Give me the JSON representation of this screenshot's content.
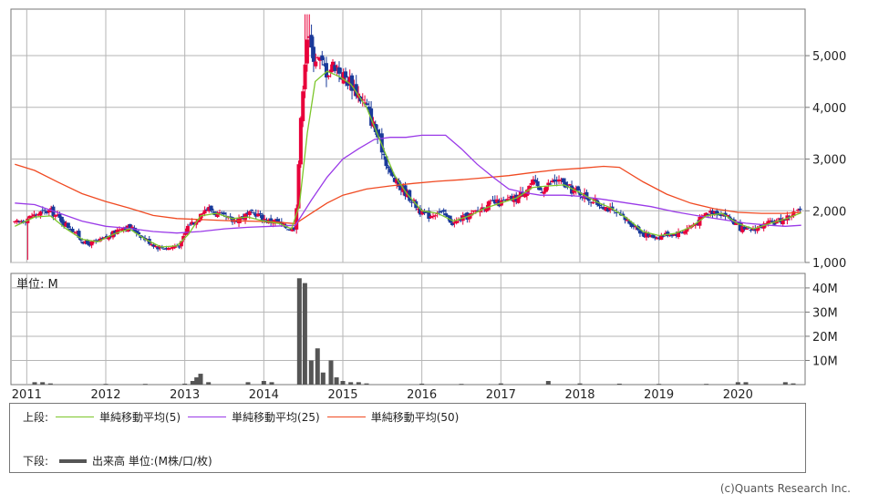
{
  "colors": {
    "up": "#e8003a",
    "down": "#1a3a9a",
    "sma5": "#7cc62a",
    "sma25": "#9a3ae8",
    "sma50": "#f04a22",
    "volume": "#555555",
    "grid": "#b5b5b5"
  },
  "price_axis": {
    "ticks": [
      1000,
      2000,
      3000,
      4000,
      5000
    ],
    "labels": [
      "1,000",
      "2,000",
      "3,000",
      "4,000",
      "5,000"
    ]
  },
  "volume_axis": {
    "unit_label": "単位: M",
    "ticks": [
      10,
      20,
      30,
      40
    ],
    "labels": [
      "10M",
      "20M",
      "30M",
      "40M"
    ]
  },
  "x_labels": [
    "2011",
    "2012",
    "2013",
    "2014",
    "2015",
    "2016",
    "2017",
    "2018",
    "2019",
    "2020"
  ],
  "legend": {
    "upper_label": "上段:",
    "sma5_label": "単純移動平均(5)",
    "sma25_label": "単純移動平均(25)",
    "sma50_label": "単純移動平均(50)",
    "lower_label": "下段:",
    "volume_label": "出来高 単位:(M株/口/枚)"
  },
  "copyright": "(c)Quants Research Inc.",
  "chart_data": {
    "type": "candlestick",
    "price_ylim": [
      1000,
      5900
    ],
    "volume_ylim": [
      0,
      46
    ],
    "x_range": [
      2010.8,
      2020.85
    ],
    "close_path": [
      [
        2010.85,
        1750
      ],
      [
        2011.0,
        1850
      ],
      [
        2011.15,
        1950
      ],
      [
        2011.3,
        2000
      ],
      [
        2011.45,
        1800
      ],
      [
        2011.6,
        1600
      ],
      [
        2011.75,
        1350
      ],
      [
        2011.9,
        1400
      ],
      [
        2012.05,
        1500
      ],
      [
        2012.2,
        1700
      ],
      [
        2012.35,
        1650
      ],
      [
        2012.5,
        1450
      ],
      [
        2012.65,
        1300
      ],
      [
        2012.8,
        1280
      ],
      [
        2012.95,
        1350
      ],
      [
        2013.05,
        1750
      ],
      [
        2013.15,
        1800
      ],
      [
        2013.2,
        2000
      ],
      [
        2013.3,
        2050
      ],
      [
        2013.45,
        1900
      ],
      [
        2013.6,
        1800
      ],
      [
        2013.75,
        1900
      ],
      [
        2013.9,
        1950
      ],
      [
        2014.05,
        1800
      ],
      [
        2014.15,
        1800
      ],
      [
        2014.25,
        1700
      ],
      [
        2014.35,
        1650
      ],
      [
        2014.4,
        1700
      ],
      [
        2014.45,
        3200
      ],
      [
        2014.5,
        4600
      ],
      [
        2014.55,
        5400
      ],
      [
        2014.6,
        5100
      ],
      [
        2014.7,
        4900
      ],
      [
        2014.8,
        4700
      ],
      [
        2014.9,
        4850
      ],
      [
        2015.0,
        4600
      ],
      [
        2015.1,
        4500
      ],
      [
        2015.2,
        4250
      ],
      [
        2015.3,
        4000
      ],
      [
        2015.4,
        3600
      ],
      [
        2015.5,
        3200
      ],
      [
        2015.6,
        2700
      ],
      [
        2015.7,
        2500
      ],
      [
        2015.8,
        2350
      ],
      [
        2015.9,
        2150
      ],
      [
        2016.0,
        1950
      ],
      [
        2016.1,
        1900
      ],
      [
        2016.2,
        2000
      ],
      [
        2016.3,
        1900
      ],
      [
        2016.4,
        1750
      ],
      [
        2016.5,
        1850
      ],
      [
        2016.6,
        1900
      ],
      [
        2016.7,
        2000
      ],
      [
        2016.8,
        2100
      ],
      [
        2016.9,
        2150
      ],
      [
        2017.0,
        2150
      ],
      [
        2017.1,
        2200
      ],
      [
        2017.2,
        2250
      ],
      [
        2017.3,
        2400
      ],
      [
        2017.4,
        2550
      ],
      [
        2017.5,
        2400
      ],
      [
        2017.6,
        2500
      ],
      [
        2017.7,
        2600
      ],
      [
        2017.8,
        2500
      ],
      [
        2017.9,
        2400
      ],
      [
        2018.0,
        2350
      ],
      [
        2018.1,
        2250
      ],
      [
        2018.2,
        2150
      ],
      [
        2018.3,
        2100
      ],
      [
        2018.4,
        2000
      ],
      [
        2018.5,
        1900
      ],
      [
        2018.6,
        1800
      ],
      [
        2018.7,
        1700
      ],
      [
        2018.8,
        1550
      ],
      [
        2018.9,
        1500
      ],
      [
        2019.0,
        1500
      ],
      [
        2019.1,
        1550
      ],
      [
        2019.2,
        1550
      ],
      [
        2019.3,
        1600
      ],
      [
        2019.4,
        1700
      ],
      [
        2019.5,
        1800
      ],
      [
        2019.6,
        1950
      ],
      [
        2019.7,
        2000
      ],
      [
        2019.8,
        1950
      ],
      [
        2019.9,
        1850
      ],
      [
        2020.0,
        1700
      ],
      [
        2020.1,
        1600
      ],
      [
        2020.2,
        1650
      ],
      [
        2020.3,
        1700
      ],
      [
        2020.4,
        1750
      ],
      [
        2020.5,
        1800
      ],
      [
        2020.6,
        1850
      ],
      [
        2020.7,
        1950
      ],
      [
        2020.8,
        2000
      ]
    ],
    "sma5": [
      [
        2010.85,
        1700
      ],
      [
        2011.1,
        1880
      ],
      [
        2011.3,
        1900
      ],
      [
        2011.5,
        1650
      ],
      [
        2011.7,
        1450
      ],
      [
        2011.9,
        1400
      ],
      [
        2012.1,
        1550
      ],
      [
        2012.3,
        1650
      ],
      [
        2012.5,
        1450
      ],
      [
        2012.7,
        1300
      ],
      [
        2012.9,
        1320
      ],
      [
        2013.05,
        1550
      ],
      [
        2013.2,
        1900
      ],
      [
        2013.4,
        1950
      ],
      [
        2013.6,
        1850
      ],
      [
        2013.8,
        1880
      ],
      [
        2014.0,
        1800
      ],
      [
        2014.2,
        1750
      ],
      [
        2014.35,
        1650
      ],
      [
        2014.45,
        2100
      ],
      [
        2014.55,
        3500
      ],
      [
        2014.65,
        4500
      ],
      [
        2014.8,
        4700
      ],
      [
        2014.95,
        4600
      ],
      [
        2015.1,
        4450
      ],
      [
        2015.3,
        4000
      ],
      [
        2015.5,
        3250
      ],
      [
        2015.65,
        2700
      ],
      [
        2015.8,
        2350
      ],
      [
        2016.0,
        2000
      ],
      [
        2016.2,
        1950
      ],
      [
        2016.4,
        1800
      ],
      [
        2016.6,
        1900
      ],
      [
        2016.8,
        2050
      ],
      [
        2017.0,
        2150
      ],
      [
        2017.2,
        2250
      ],
      [
        2017.4,
        2450
      ],
      [
        2017.6,
        2480
      ],
      [
        2017.8,
        2500
      ],
      [
        2018.0,
        2350
      ],
      [
        2018.2,
        2180
      ],
      [
        2018.4,
        2050
      ],
      [
        2018.6,
        1850
      ],
      [
        2018.8,
        1600
      ],
      [
        2019.0,
        1520
      ],
      [
        2019.2,
        1560
      ],
      [
        2019.4,
        1680
      ],
      [
        2019.6,
        1900
      ],
      [
        2019.8,
        1950
      ],
      [
        2020.0,
        1750
      ],
      [
        2020.2,
        1650
      ],
      [
        2020.4,
        1750
      ],
      [
        2020.6,
        1840
      ],
      [
        2020.8,
        1960
      ]
    ],
    "sma25": [
      [
        2010.85,
        2150
      ],
      [
        2011.1,
        2120
      ],
      [
        2011.4,
        1960
      ],
      [
        2011.7,
        1800
      ],
      [
        2012.0,
        1700
      ],
      [
        2012.3,
        1660
      ],
      [
        2012.6,
        1600
      ],
      [
        2012.9,
        1570
      ],
      [
        2013.2,
        1600
      ],
      [
        2013.5,
        1650
      ],
      [
        2013.8,
        1680
      ],
      [
        2014.1,
        1700
      ],
      [
        2014.4,
        1720
      ],
      [
        2014.6,
        2200
      ],
      [
        2014.8,
        2650
      ],
      [
        2015.0,
        3000
      ],
      [
        2015.2,
        3200
      ],
      [
        2015.4,
        3380
      ],
      [
        2015.6,
        3420
      ],
      [
        2015.8,
        3420
      ],
      [
        2016.0,
        3460
      ],
      [
        2016.3,
        3460
      ],
      [
        2016.5,
        3200
      ],
      [
        2016.7,
        2900
      ],
      [
        2016.9,
        2650
      ],
      [
        2017.1,
        2420
      ],
      [
        2017.3,
        2350
      ],
      [
        2017.5,
        2300
      ],
      [
        2017.8,
        2300
      ],
      [
        2018.0,
        2280
      ],
      [
        2018.3,
        2220
      ],
      [
        2018.6,
        2150
      ],
      [
        2018.9,
        2080
      ],
      [
        2019.2,
        1980
      ],
      [
        2019.5,
        1900
      ],
      [
        2019.8,
        1830
      ],
      [
        2020.1,
        1760
      ],
      [
        2020.4,
        1720
      ],
      [
        2020.6,
        1700
      ],
      [
        2020.8,
        1720
      ]
    ],
    "sma50": [
      [
        2010.85,
        2900
      ],
      [
        2011.1,
        2780
      ],
      [
        2011.4,
        2550
      ],
      [
        2011.7,
        2330
      ],
      [
        2012.0,
        2180
      ],
      [
        2012.3,
        2050
      ],
      [
        2012.6,
        1910
      ],
      [
        2012.9,
        1850
      ],
      [
        2013.2,
        1830
      ],
      [
        2013.5,
        1810
      ],
      [
        2013.8,
        1800
      ],
      [
        2014.1,
        1790
      ],
      [
        2014.4,
        1750
      ],
      [
        2014.6,
        1950
      ],
      [
        2014.8,
        2150
      ],
      [
        2015.0,
        2300
      ],
      [
        2015.3,
        2420
      ],
      [
        2015.6,
        2480
      ],
      [
        2015.9,
        2530
      ],
      [
        2016.2,
        2570
      ],
      [
        2016.5,
        2600
      ],
      [
        2016.8,
        2640
      ],
      [
        2017.1,
        2680
      ],
      [
        2017.4,
        2740
      ],
      [
        2017.7,
        2790
      ],
      [
        2018.0,
        2820
      ],
      [
        2018.3,
        2860
      ],
      [
        2018.5,
        2840
      ],
      [
        2018.8,
        2560
      ],
      [
        2019.1,
        2320
      ],
      [
        2019.4,
        2150
      ],
      [
        2019.7,
        2040
      ],
      [
        2020.0,
        1970
      ],
      [
        2020.3,
        1950
      ],
      [
        2020.6,
        1950
      ],
      [
        2020.8,
        1970
      ]
    ],
    "volume": [
      [
        2011.1,
        1
      ],
      [
        2011.2,
        1
      ],
      [
        2011.3,
        0.5
      ],
      [
        2012.0,
        0.3
      ],
      [
        2012.5,
        0.3
      ],
      [
        2013.0,
        0.4
      ],
      [
        2013.1,
        1.5
      ],
      [
        2013.15,
        3
      ],
      [
        2013.2,
        4.5
      ],
      [
        2013.3,
        1
      ],
      [
        2013.8,
        1
      ],
      [
        2014.0,
        1.5
      ],
      [
        2014.1,
        1
      ],
      [
        2014.45,
        44
      ],
      [
        2014.52,
        42
      ],
      [
        2014.6,
        10
      ],
      [
        2014.68,
        15
      ],
      [
        2014.75,
        5
      ],
      [
        2014.85,
        10
      ],
      [
        2014.92,
        3
      ],
      [
        2015.0,
        1.5
      ],
      [
        2015.1,
        1
      ],
      [
        2015.2,
        1
      ],
      [
        2015.3,
        0.5
      ],
      [
        2016.0,
        0.4
      ],
      [
        2016.5,
        0.3
      ],
      [
        2017.0,
        0.5
      ],
      [
        2017.6,
        1.5
      ],
      [
        2018.0,
        0.5
      ],
      [
        2018.5,
        0.4
      ],
      [
        2019.0,
        0.3
      ],
      [
        2019.6,
        0.3
      ],
      [
        2020.0,
        1
      ],
      [
        2020.1,
        1
      ],
      [
        2020.6,
        1
      ],
      [
        2020.7,
        0.5
      ]
    ]
  }
}
